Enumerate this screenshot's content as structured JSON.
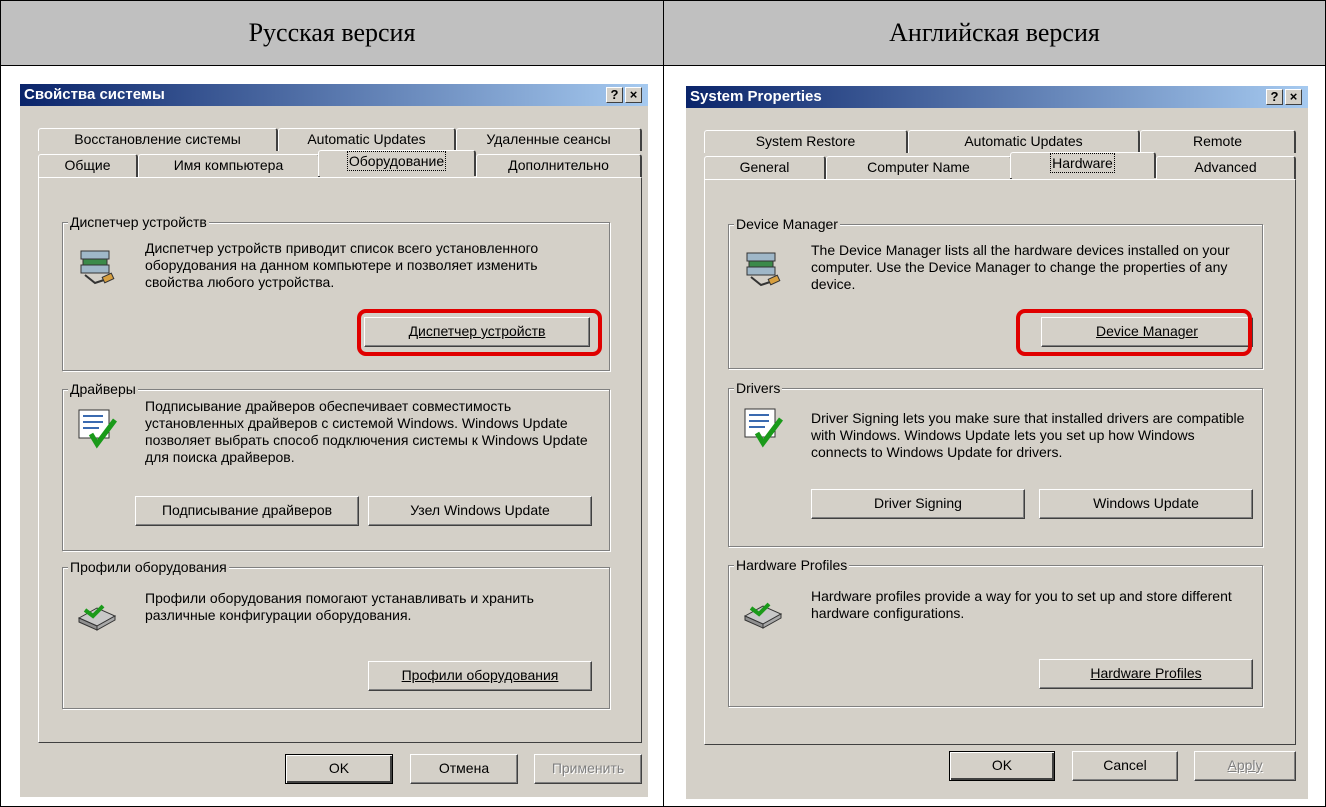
{
  "headers": {
    "left": "Русская версия",
    "right": "Английская версия"
  },
  "ru": {
    "title": "Свойства системы",
    "help_btn": "?",
    "close_btn": "×",
    "tabs_back": [
      "Восстановление системы",
      "Automatic Updates",
      "Удаленные сеансы"
    ],
    "tabs_front": [
      "Общие",
      "Имя компьютера",
      "Оборудование",
      "Дополнительно"
    ],
    "dm": {
      "label": "Диспетчер устройств",
      "text": "Диспетчер устройств приводит список всего установленного оборудования на данном компьютере и позволяет изменить свойства любого устройства.",
      "button": "Диспетчер устройств"
    },
    "drivers": {
      "label": "Драйверы",
      "text": "Подписывание драйверов обеспечивает совместимость установленных драйверов с системой Windows. Windows Update позволяет выбрать способ подключения системы к Windows Update для поиска драйверов.",
      "btn_signing": "Подписывание драйверов",
      "btn_update": "Узел Windows Update"
    },
    "profiles": {
      "label": "Профили оборудования",
      "text": "Профили оборудования помогают устанавливать и хранить различные конфигурации оборудования.",
      "button": "Профили оборудования"
    },
    "ok": "OK",
    "cancel": "Отмена",
    "apply": "Применить"
  },
  "en": {
    "title": "System Properties",
    "help_btn": "?",
    "close_btn": "×",
    "tabs_back": [
      "System Restore",
      "Automatic Updates",
      "Remote"
    ],
    "tabs_front": [
      "General",
      "Computer Name",
      "Hardware",
      "Advanced"
    ],
    "dm": {
      "label": "Device Manager",
      "text": "The Device Manager lists all the hardware devices installed on your computer. Use the Device Manager to change the properties of any device.",
      "button": "Device Manager"
    },
    "drivers": {
      "label": "Drivers",
      "text": "Driver Signing lets you make sure that installed drivers are compatible with Windows. Windows Update lets you set up how Windows connects to Windows Update for drivers.",
      "btn_signing": "Driver Signing",
      "btn_update": "Windows Update"
    },
    "profiles": {
      "label": "Hardware Profiles",
      "text": "Hardware profiles provide a way for you to set up and store different hardware configurations.",
      "button": "Hardware Profiles"
    },
    "ok": "OK",
    "cancel": "Cancel",
    "apply": "Apply"
  },
  "colors": {
    "highlight": "#e00000",
    "titlebar_start": "#0a246a",
    "titlebar_end": "#a6caf0",
    "dialog_face": "#d4d0c8",
    "header_bg": "#c0c0c0"
  }
}
